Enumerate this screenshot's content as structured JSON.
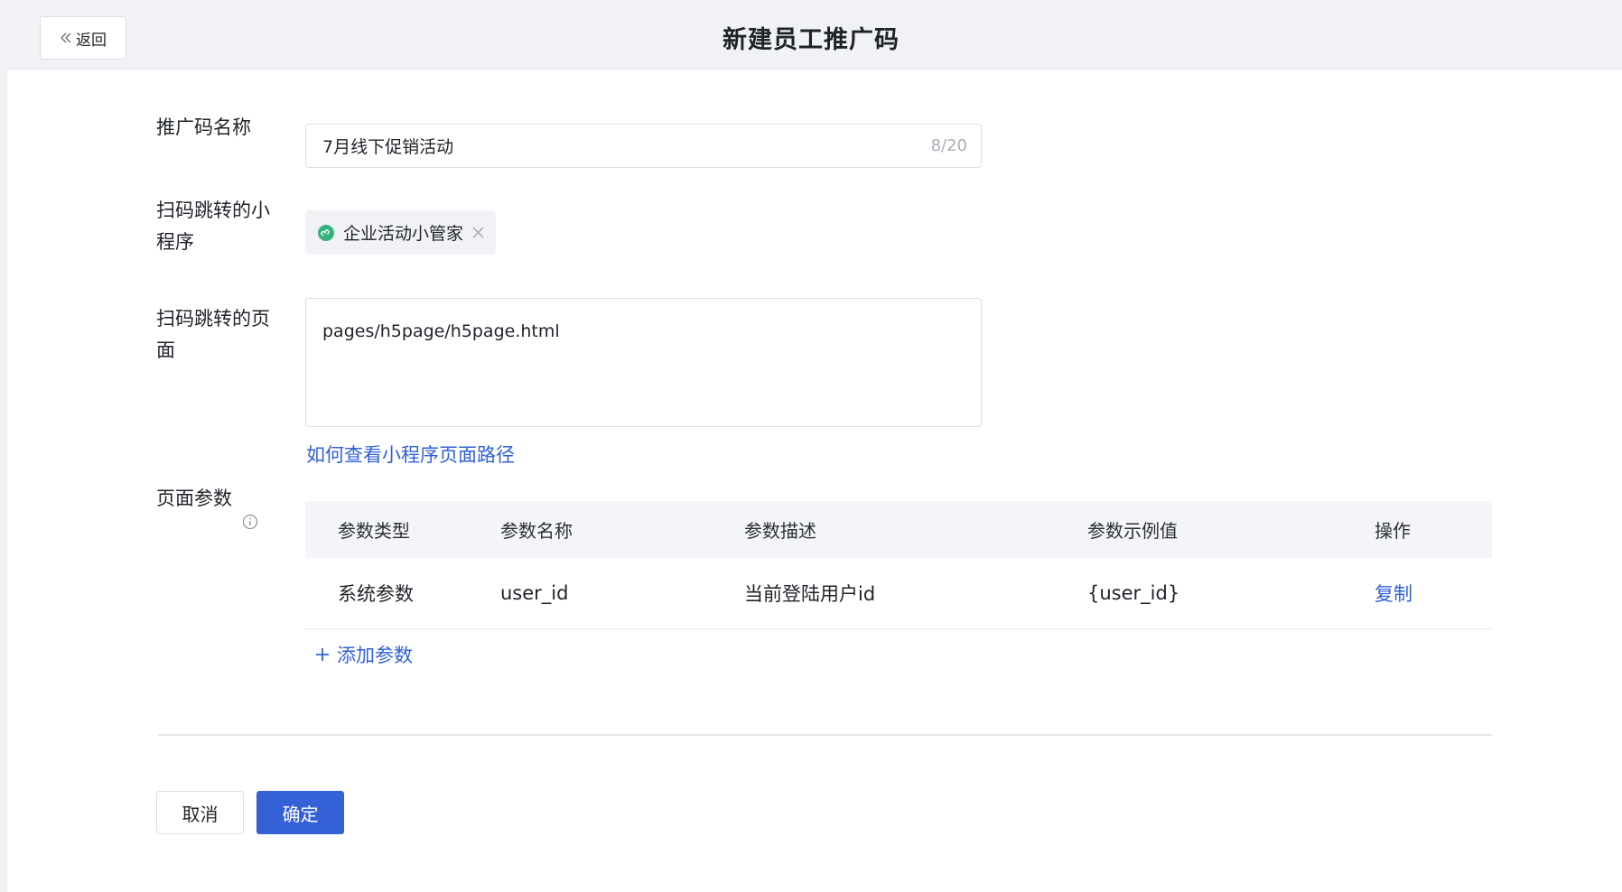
{
  "header": {
    "back_label": "返回",
    "title": "新建员工推广码"
  },
  "form": {
    "name": {
      "label": "推广码名称",
      "value": "7月线下促销活动",
      "count": "8/20"
    },
    "miniprogram": {
      "label_line1": "扫码跳转的小",
      "label_line2": "程序",
      "tag": "企业活动小管家"
    },
    "page": {
      "label_line1": "扫码跳转的页",
      "label_line2": "面",
      "value": "pages/h5page/h5page.html",
      "help_link": "如何查看小程序页面路径"
    },
    "params": {
      "label": "页面参数",
      "columns": [
        "参数类型",
        "参数名称",
        "参数描述",
        "参数示例值",
        "操作"
      ],
      "rows": [
        {
          "type": "系统参数",
          "name": "user_id",
          "desc": "当前登陆用户id",
          "example": "{user_id}",
          "action": "复制"
        }
      ],
      "add_label": "添加参数"
    }
  },
  "footer": {
    "cancel_label": "取消",
    "ok_label": "确定"
  },
  "colors": {
    "accent": "#3461d6",
    "link": "#3161d6",
    "miniprogram_icon": "#34b27a"
  },
  "icons": {
    "back": "double-chevron-left-icon",
    "miniprogram": "miniprogram-icon",
    "close": "close-icon",
    "info": "info-icon",
    "add": "plus-icon"
  }
}
